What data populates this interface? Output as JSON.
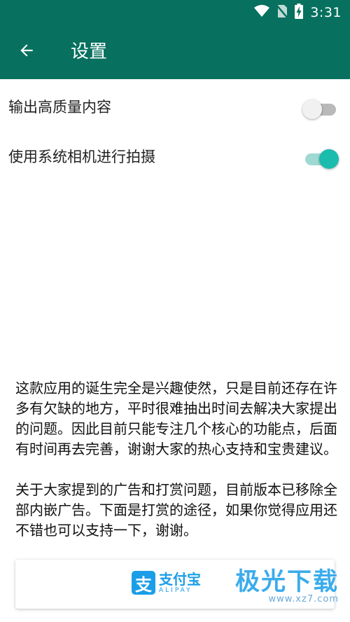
{
  "status_bar": {
    "time": "3:31"
  },
  "toolbar": {
    "title": "设置"
  },
  "settings": [
    {
      "label": "输出高质量内容",
      "enabled": false
    },
    {
      "label": "使用系统相机进行拍摄",
      "enabled": true
    }
  ],
  "about": {
    "paragraph1": "这款应用的诞生完全是兴趣使然，只是目前还存在许多有欠缺的地方，平时很难抽出时间去解决大家提出的问题。因此目前只能专注几个核心的功能点，后面有时间再去完善，谢谢大家的热心支持和宝贵建议。",
    "paragraph2": "关于大家提到的广告和打赏问题，目前版本已移除全部内嵌广告。下面是打赏的途径，如果你觉得应用还不错也可以支持一下，谢谢。"
  },
  "donate": {
    "alipay_mark": "支",
    "alipay_cn": "支付宝",
    "alipay_en": "ALIPAY"
  },
  "watermark": {
    "main": "极光下载",
    "url": "www.xz7.com"
  },
  "colors": {
    "primary": "#07705e",
    "accent": "#1bbcae",
    "alipay": "#1a9ee8"
  }
}
